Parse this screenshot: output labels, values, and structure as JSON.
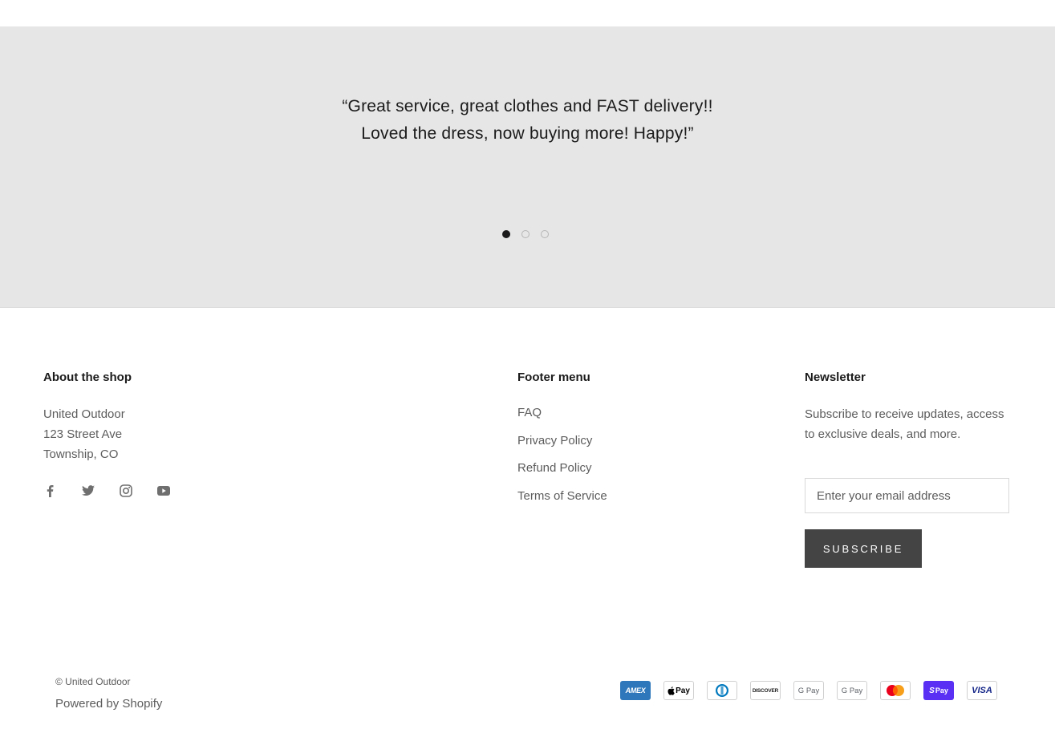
{
  "testimonial": {
    "line1": "“Great service, great clothes and FAST delivery!!",
    "line2": "Loved the dress, now buying more! Happy!”",
    "active_slide": 1,
    "slide_count": 3
  },
  "about": {
    "title": "About the shop",
    "address_line1": "United Outdoor",
    "address_line2": "123 Street Ave",
    "address_line3": "Township, CO",
    "social": [
      "facebook-icon",
      "twitter-icon",
      "instagram-icon",
      "youtube-icon"
    ]
  },
  "footer_menu": {
    "title": "Footer menu",
    "items": [
      "FAQ",
      "Privacy Policy",
      "Refund Policy",
      "Terms of Service"
    ]
  },
  "newsletter": {
    "title": "Newsletter",
    "text": "Subscribe to receive updates, access to exclusive deals, and more.",
    "email_placeholder": "Enter your email address",
    "email_value": "",
    "subscribe_label": "Subscribe"
  },
  "bottom": {
    "copyright": "© United Outdoor",
    "powered": "Powered by Shopify",
    "payments": [
      {
        "name": "American Express",
        "label": "AMEX",
        "color": "#2e77bb"
      },
      {
        "name": "Apple Pay",
        "label": "Pay",
        "color": "#000000"
      },
      {
        "name": "Diners Club",
        "label": "",
        "color": "#0079be"
      },
      {
        "name": "Discover",
        "label": "DISCOVER",
        "color": "#f48120"
      },
      {
        "name": "Google Pay",
        "label": "G Pay",
        "color": "#5f6368"
      },
      {
        "name": "Google Pay",
        "label": "G Pay",
        "color": "#5f6368"
      },
      {
        "name": "Mastercard",
        "label": "",
        "color": "#eb001b"
      },
      {
        "name": "Shop Pay",
        "label": "Pay",
        "color": "#5a31f4"
      },
      {
        "name": "Visa",
        "label": "VISA",
        "color": "#142688"
      }
    ]
  },
  "colors": {
    "testimonial_bg": "#e6e6e6",
    "heading": "#1c1b1b",
    "text": "#5c5c5c",
    "button_bg": "#444444"
  }
}
